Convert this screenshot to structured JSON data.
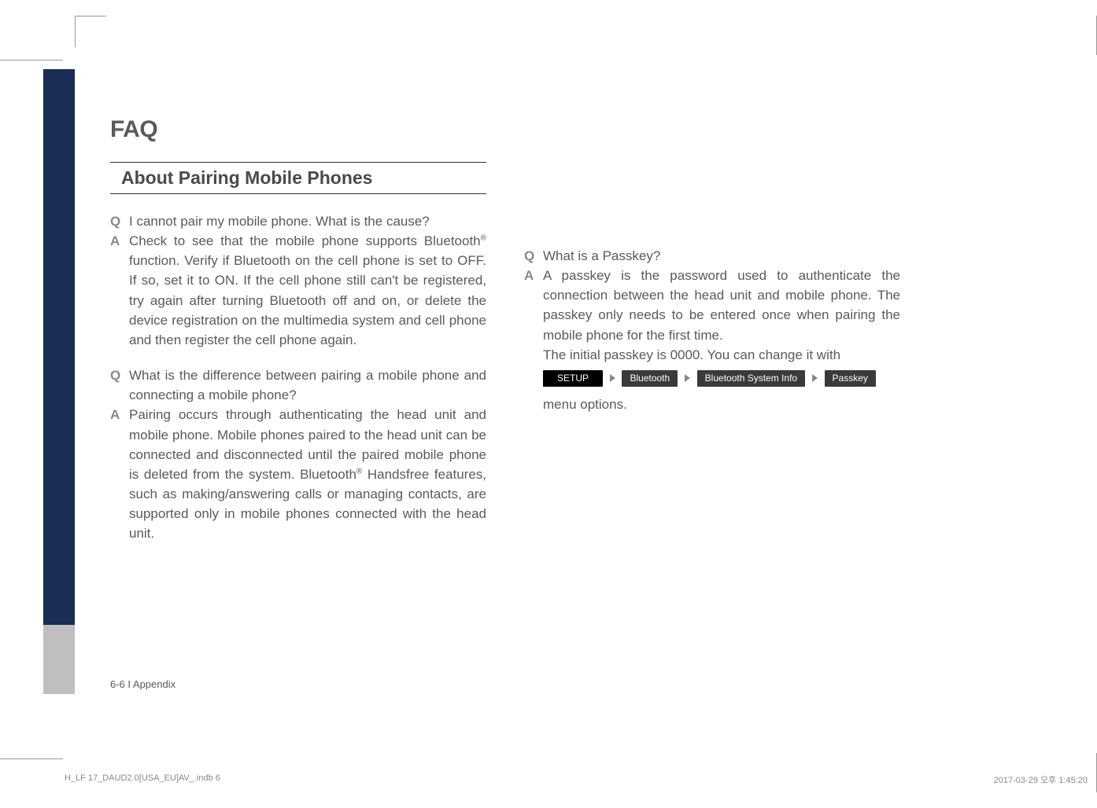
{
  "page_title": "FAQ",
  "section_heading": "About Pairing Mobile Phones",
  "left_column": {
    "qa1": {
      "q_label": "Q",
      "q_text": "I cannot pair my mobile phone. What is the cause?",
      "a_label": "A",
      "a_text": "Check to see that the mobile phone supports Bluetooth® func­tion. Verify if Bluetooth on the cell phone is set to OFF. If so, set it to ON. If the cell phone still can't be registered, try again after turning Bluetooth off and on, or delete the device registration on the multimedia system and cell phone and then register the cell phone again."
    },
    "qa2": {
      "q_label": "Q",
      "q_text": "What is the difference between pairing a mobile phone and connecting a mobile phone?",
      "a_label": "A",
      "a_text": "Pairing occurs through authenticating the head unit and mobile phone. Mobile phones paired to the head unit can be connected and disconnected until the paired mobile phone is deleted from the system. Bluetooth® Handsfree features, such as making/answering calls or managing contacts, are supported only in mobile phones connected with the head unit."
    }
  },
  "right_column": {
    "qa1": {
      "q_label": "Q",
      "q_text": "What is a Passkey?",
      "a_label": "A",
      "a_text_1": "A passkey is the password used to authenticate the connection between the head unit and mobile phone. The passkey only needs to be entered once when pairing the mobile phone for the first time.",
      "a_text_2": "The initial passkey is 0000. You can change it with",
      "menu_path": {
        "step1": "SETUP",
        "step2": "Bluetooth",
        "step3": "Bluetooth System Info",
        "step4": "Passkey"
      },
      "a_text_3_suffix": " menu options."
    }
  },
  "footer": "6-6 I Appendix",
  "print_footer": {
    "left": "H_LF 17_DAUD2.0[USA_EU]AV_.indb   6",
    "right": "2017-03-29   오후 1:45:20"
  }
}
